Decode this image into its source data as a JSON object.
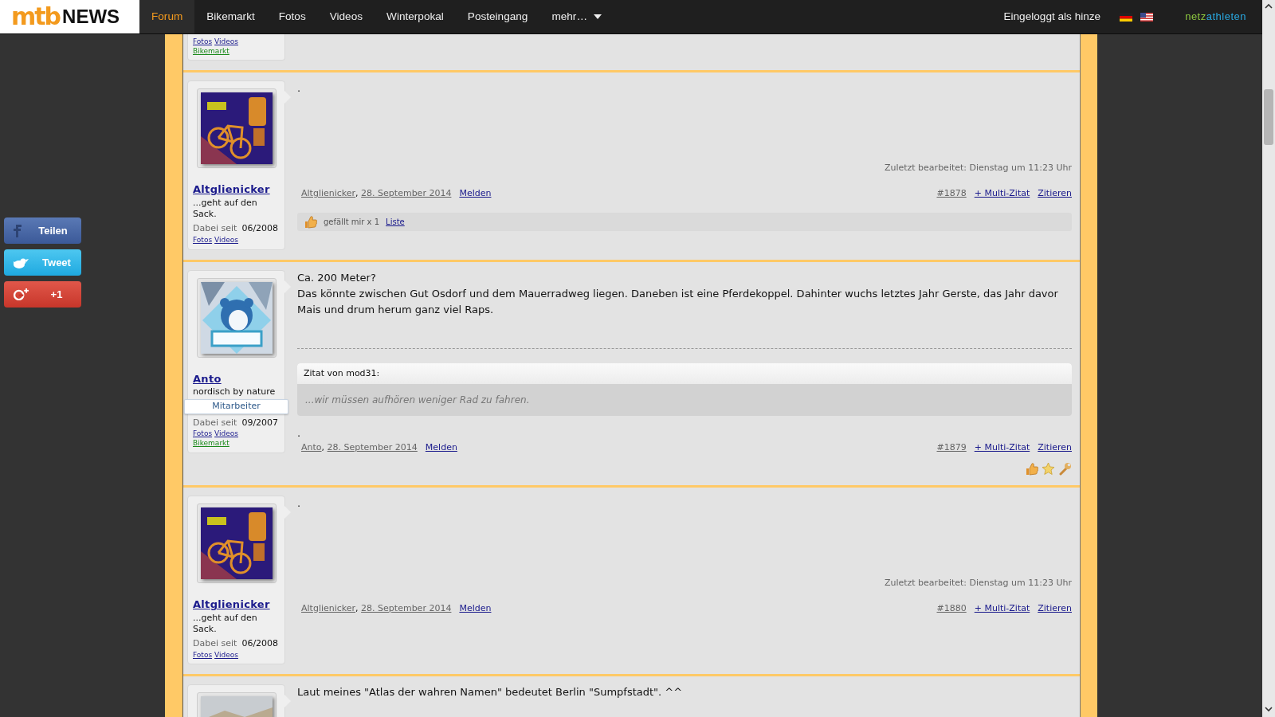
{
  "navbar": {
    "logo": {
      "mark": "mtb",
      "word": "NEWS"
    },
    "items": [
      {
        "label": "Forum",
        "selected": true,
        "dropdown": false
      },
      {
        "label": "Bikemarkt",
        "selected": false,
        "dropdown": false
      },
      {
        "label": "Fotos",
        "selected": false,
        "dropdown": false
      },
      {
        "label": "Videos",
        "selected": false,
        "dropdown": false
      },
      {
        "label": "Winterpokal",
        "selected": false,
        "dropdown": false
      },
      {
        "label": "Posteingang",
        "selected": false,
        "dropdown": false
      },
      {
        "label": "mehr…",
        "selected": false,
        "dropdown": true
      }
    ],
    "login": "Eingeloggt als hinze",
    "brand": {
      "first": "netz",
      "second": "athleten"
    }
  },
  "share_buttons": [
    {
      "kind": "facebook",
      "label": "Teilen"
    },
    {
      "kind": "twitter",
      "label": "Tweet"
    },
    {
      "kind": "googleplus",
      "label": "+1"
    }
  ],
  "posts": [
    {
      "partial": true,
      "user": {
        "links": [
          {
            "label": "Fotos",
            "kind": "profile"
          },
          {
            "label": "Videos",
            "kind": "profile"
          },
          {
            "label": "Bikemarkt",
            "kind": "market"
          }
        ]
      }
    },
    {
      "user": {
        "avatar": {
          "kind": "picture"
        },
        "name": "Altglienicker",
        "title": "...geht auf den Sack.",
        "since_label": "Dabei seit",
        "since": "06/2008",
        "links": [
          {
            "label": "Fotos",
            "kind": "profile"
          },
          {
            "label": "Videos",
            "kind": "profile"
          }
        ]
      },
      "body": [
        "."
      ],
      "edited": "Zuletzt bearbeitet: Dienstag um 11:23 Uhr",
      "author": "Altglienicker",
      "separator": ",",
      "date": "28. September 2014",
      "report": "Melden",
      "number": "#1878",
      "multiquote": "+ Multi-Zitat",
      "quote": "Zitieren",
      "likes": {
        "text": "gefällt mir x 1",
        "link": "Liste"
      }
    },
    {
      "user": {
        "avatar": {
          "kind": "picture"
        },
        "name": "Anto",
        "title": "nordisch by nature",
        "badge": "Mitarbeiter",
        "since_label": "Dabei seit",
        "since": "09/2007",
        "links": [
          {
            "label": "Fotos",
            "kind": "profile"
          },
          {
            "label": "Videos",
            "kind": "profile"
          },
          {
            "label": "Bikemarkt",
            "kind": "market"
          }
        ]
      },
      "body": [
        "Ca. 200 Meter?",
        "Das könnte zwischen Gut Osdorf und dem Mauerradweg liegen. Daneben ist eine Pferdekoppel. Dahinter wuchs letztes Jahr Gerste, das Jahr davor Mais und drum herum ganz viel Raps."
      ],
      "signature": {
        "quote_header": "Zitat von mod31:",
        "quote_text": "...wir müssen aufhören weniger Rad zu fahren.",
        "after": "."
      },
      "author": "Anto",
      "separator": ",",
      "date": "28. September 2014",
      "report": "Melden",
      "number": "#1879",
      "multiquote": "+ Multi-Zitat",
      "quote": "Zitieren",
      "tools": true
    },
    {
      "user": {
        "avatar": {
          "kind": "picture"
        },
        "name": "Altglienicker",
        "title": "...geht auf den Sack.",
        "since_label": "Dabei seit",
        "since": "06/2008",
        "links": [
          {
            "label": "Fotos",
            "kind": "profile"
          },
          {
            "label": "Videos",
            "kind": "profile"
          }
        ]
      },
      "body": [
        "."
      ],
      "edited": "Zuletzt bearbeitet: Dienstag um 11:23 Uhr",
      "author": "Altglienicker",
      "separator": ",",
      "date": "28. September 2014",
      "report": "Melden",
      "number": "#1880",
      "multiquote": "+ Multi-Zitat",
      "quote": "Zitieren"
    },
    {
      "user": {
        "avatar": {
          "kind": "picture"
        }
      },
      "body": [
        "Laut meines \"Atlas der wahren Namen\" bedeutet Berlin \"Sumpfstadt\". ^^"
      ]
    }
  ]
}
